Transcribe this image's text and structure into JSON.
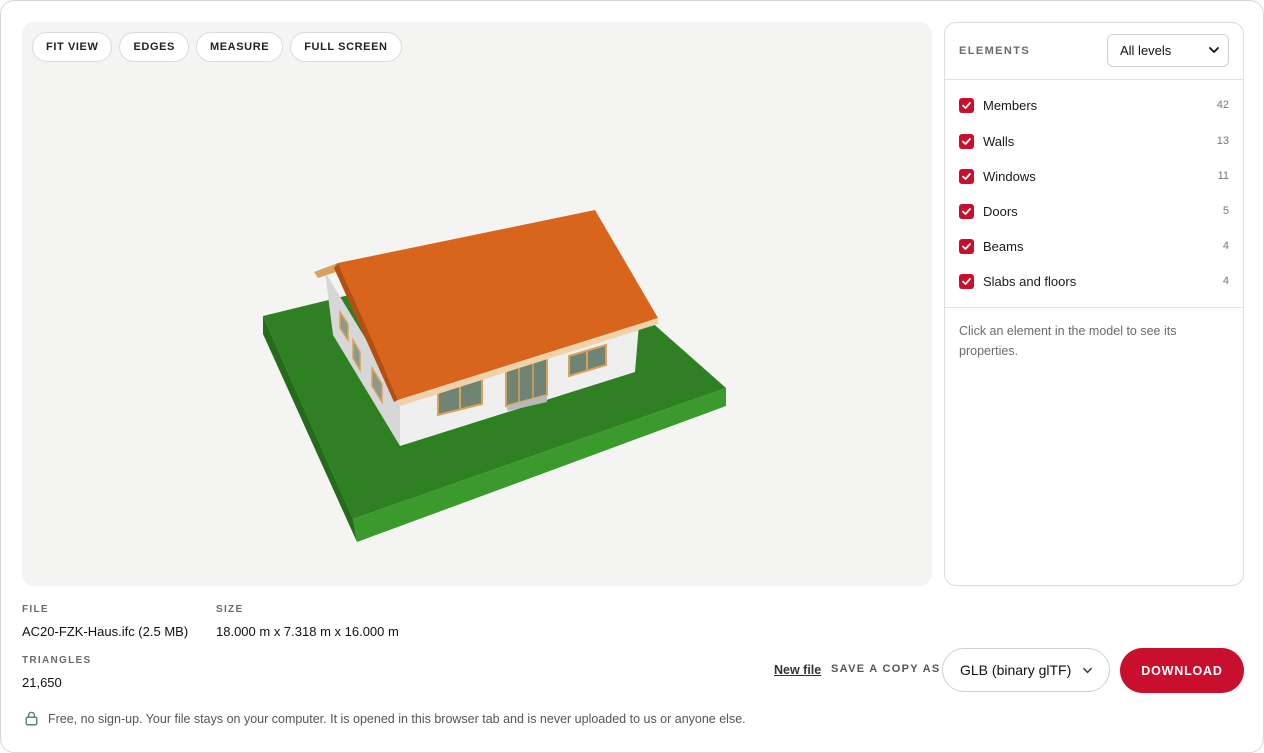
{
  "toolbar": {
    "fit_view": "FIT VIEW",
    "edges": "EDGES",
    "measure": "MEASURE",
    "full_screen": "FULL SCREEN"
  },
  "elements_panel": {
    "title": "ELEMENTS",
    "level_select": "All levels",
    "items": [
      {
        "label": "Members",
        "count": "42",
        "checked": true
      },
      {
        "label": "Walls",
        "count": "13",
        "checked": true
      },
      {
        "label": "Windows",
        "count": "11",
        "checked": true
      },
      {
        "label": "Doors",
        "count": "5",
        "checked": true
      },
      {
        "label": "Beams",
        "count": "4",
        "checked": true
      },
      {
        "label": "Slabs and floors",
        "count": "4",
        "checked": true
      }
    ],
    "hint": "Click an element in the model to see its properties."
  },
  "file_info": {
    "file_label": "FILE",
    "file_value": "AC20-FZK-Haus.ifc (2.5 MB)",
    "size_label": "SIZE",
    "size_value": "18.000 m x 7.318 m x 16.000 m",
    "triangles_label": "TRIANGLES",
    "triangles_value": "21,650"
  },
  "actions": {
    "new_file": "New file",
    "save_copy_label": "SAVE A COPY AS",
    "format_select": "GLB (binary glTF)",
    "download": "DOWNLOAD"
  },
  "privacy_note": "Free, no sign-up. Your file stays on your computer. It is opened in this browser tab and is never uploaded to us or anyone else.",
  "colors": {
    "accent": "#c8102e",
    "viewer_bg": "#f4f4f2",
    "roof": "#d9641c",
    "ground": "#2f7f23",
    "walls": "#ececec"
  },
  "icons": {
    "checkbox": "check-icon",
    "select": "chevron-down-icon",
    "privacy": "lock-icon"
  }
}
